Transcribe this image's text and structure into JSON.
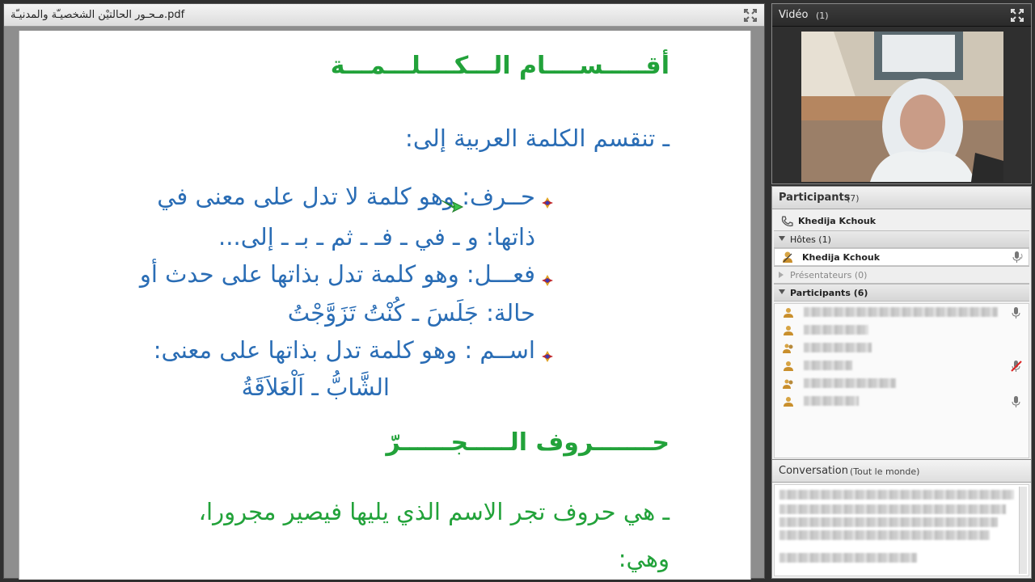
{
  "document": {
    "title": "مـحـور الحالتيْن الشخصيـّة والمدنيـّة.pdf",
    "heading1": "أقـــــســــام الـــكــــلـــمـــة",
    "intro": "ـ تنقسم الكلمة العربية إلى:",
    "item1_line1": "حــرف: وهو كلمة لا تدل على معنى في",
    "item1_line2": "ذاتها: و ـ في ـ فـ ـ ثم ـ بـ ـ إلى...",
    "item2_line1": "فعـــل: وهو كلمة تدل بذاتها على حدث أو",
    "item2_line2": "حالة: جَلَسَ ـ كُنْتُ تَزَوَّجْتُ",
    "item3_line1": "اســم : وهو كلمة تدل بذاتها على معنى:",
    "item3_line2": "الشَّابُّ ـ اَلْعَلاَقَةُ",
    "heading2": "حـــــــروف الـــــجــــــرّ",
    "def_line1": "ـ هي حروف تجر الاسم الذي يليها فيصير مجرورا،",
    "def_line2": "وهي:",
    "colors": {
      "heading": "#22a23a",
      "body": "#2a6db5"
    }
  },
  "video": {
    "title": "Vidéo",
    "count": "(1)",
    "expand_icon": "expand-icon"
  },
  "participants": {
    "title": "Participants",
    "count": "(7)",
    "phone_user": "Khedija Kchouk",
    "hosts_label": "Hôtes (1)",
    "host_name": "Khedija Kchouk",
    "presenters_label": "Présentateurs (0)",
    "participants_label": "Participants (6)"
  },
  "conversation": {
    "title": "Conversation",
    "scope": "(Tout le monde)"
  }
}
